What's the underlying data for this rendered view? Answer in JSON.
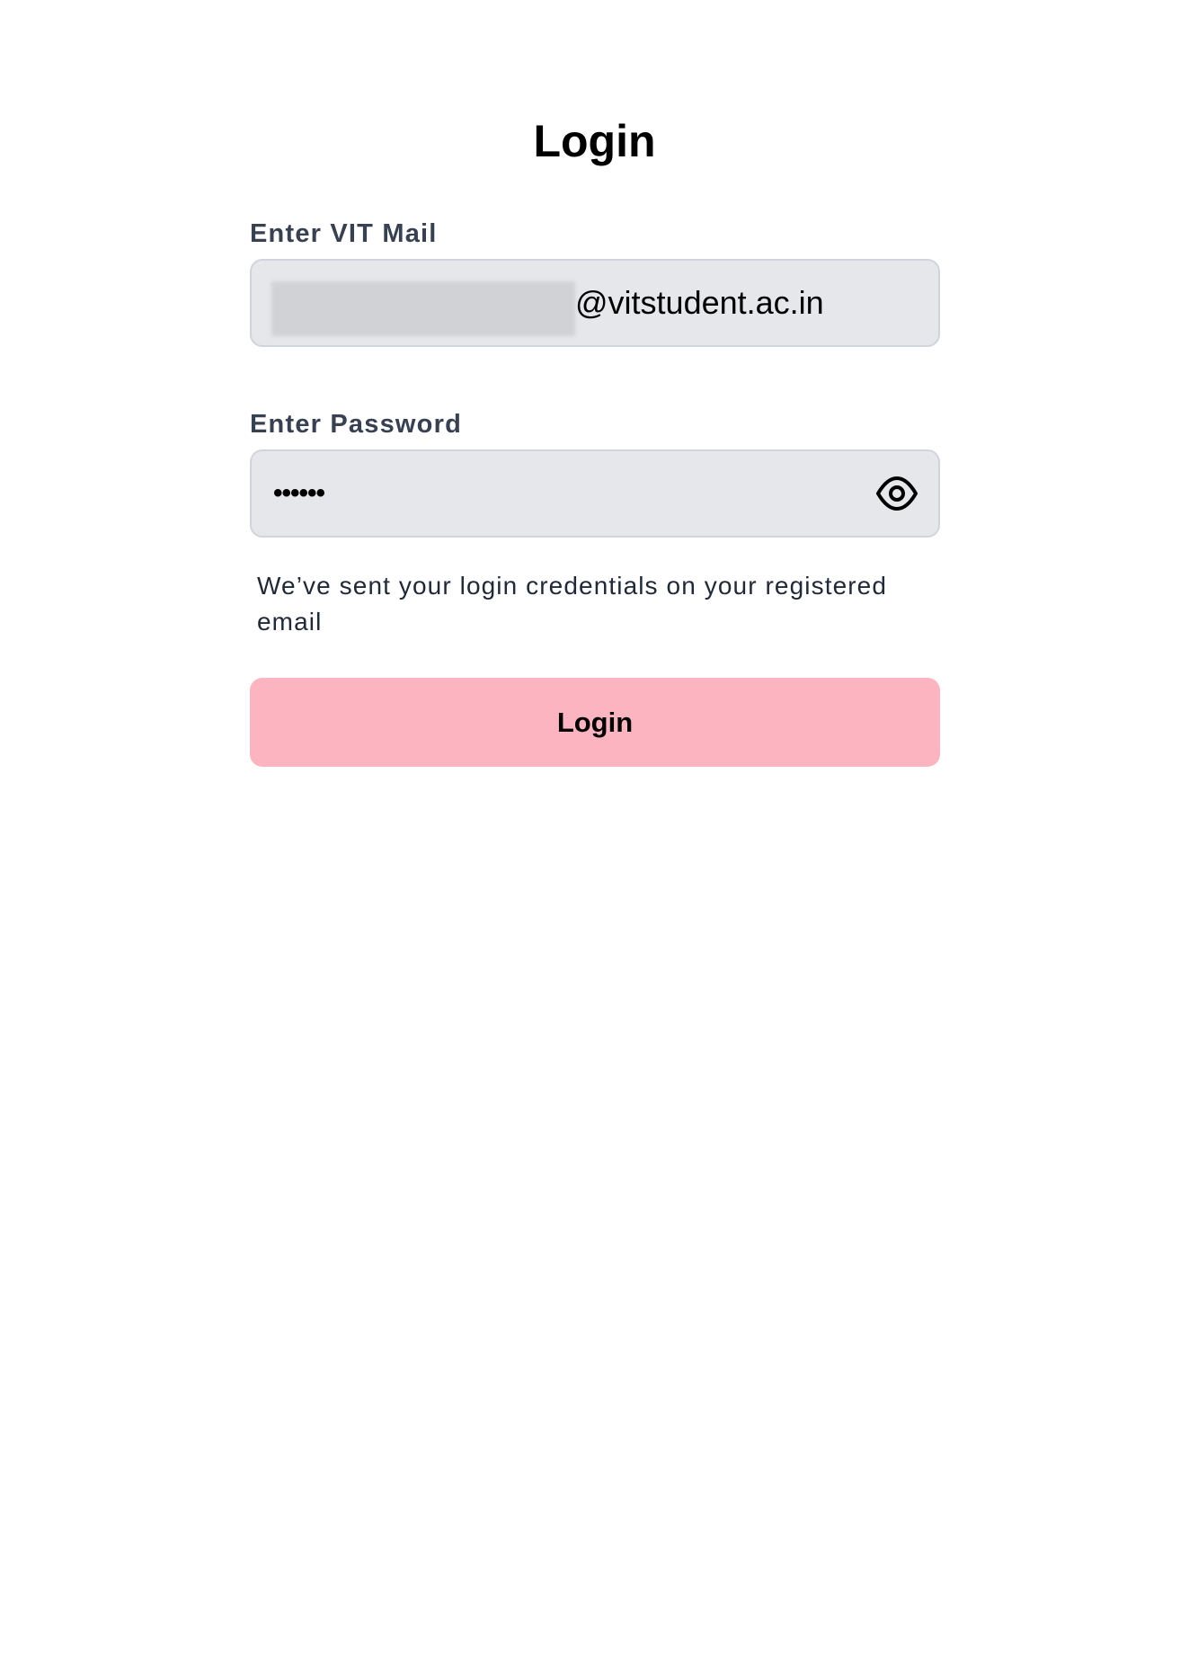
{
  "page": {
    "title": "Login"
  },
  "form": {
    "email": {
      "label": "Enter VIT Mail",
      "value_suffix": "@vitstudent.ac.in",
      "redacted": true
    },
    "password": {
      "label": "Enter Password",
      "value_masked": "••••••",
      "toggle_icon": "eye-icon"
    },
    "helper_text": "We’ve sent your login credentials on your registered email",
    "submit_label": "Login"
  },
  "colors": {
    "button_bg": "#fbb4c0",
    "field_bg": "#e5e7eb",
    "label_color": "#374151"
  }
}
